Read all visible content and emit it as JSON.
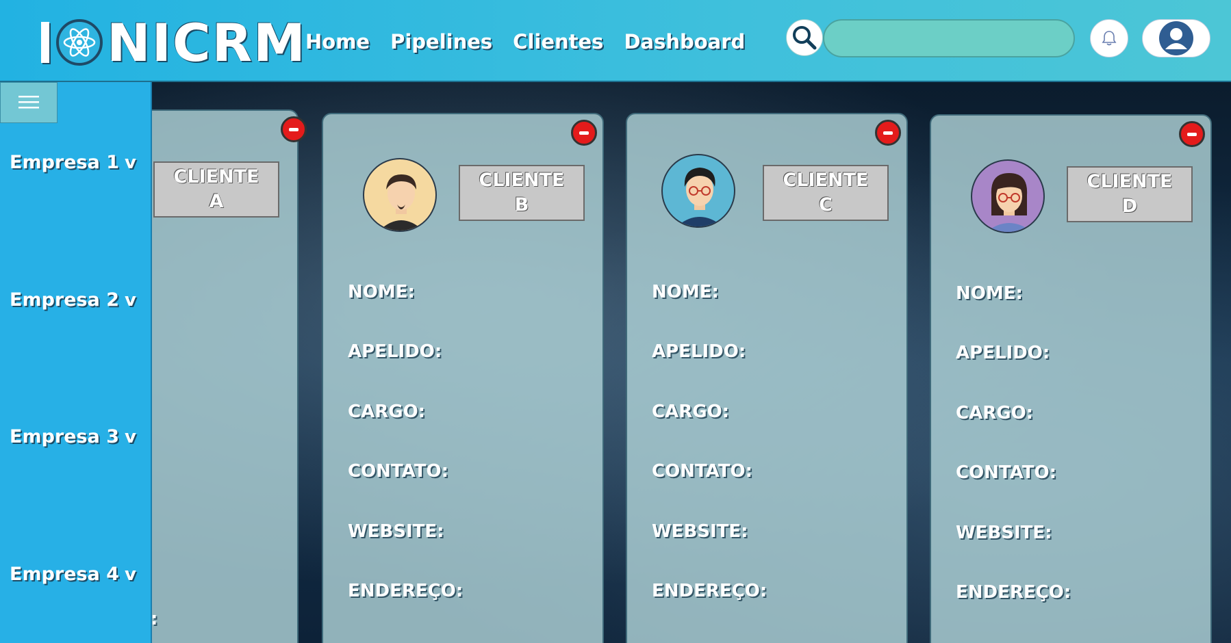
{
  "app": {
    "logo_text": "NICRM"
  },
  "nav": {
    "items": [
      "Home",
      "Pipelines",
      "Clientes",
      "Dashboard"
    ]
  },
  "search": {
    "value": "",
    "placeholder": ""
  },
  "sidebar": {
    "companies": [
      "Empresa 1",
      "Empresa 2",
      "Empresa 3",
      "Empresa 4"
    ]
  },
  "partial_card": {
    "client_label": "CLIENTE\nA",
    "partial_text": ":"
  },
  "cards": [
    {
      "client_label": "CLIENTE\nB",
      "avatar_icon": "male-beard-avatar-icon",
      "fields": [
        "NOME:",
        "APELIDO:",
        "CARGO:",
        "CONTATO:",
        "WEBSITE:",
        "ENDEREÇO:"
      ]
    },
    {
      "client_label": "CLIENTE\nC",
      "avatar_icon": "male-glasses-avatar-icon",
      "fields": [
        "NOME:",
        "APELIDO:",
        "CARGO:",
        "CONTATO:",
        "WEBSITE:",
        "ENDEREÇO:"
      ]
    },
    {
      "client_label": "CLIENTE\nD",
      "avatar_icon": "female-glasses-avatar-icon",
      "fields": [
        "NOME:",
        "APELIDO:",
        "CARGO:",
        "CONTATO:",
        "WEBSITE:",
        "ENDEREÇO:"
      ]
    }
  ],
  "colors": {
    "header": "#3fc0dc",
    "sidebar": "#27b0e6",
    "remove_button": "#e41b1b",
    "client_button": "#c8c8c8"
  }
}
